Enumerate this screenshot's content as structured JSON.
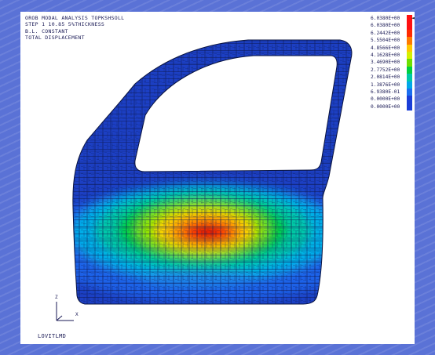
{
  "header": {
    "line1": "OROB MODAL ANALYSIS TOPKSHSOLL",
    "line2": "STEP 1 10.85 5%THICKNESS",
    "line3": "B.L. CONSTANT",
    "line4": "TOTAL DISPLACEMENT"
  },
  "legend": {
    "marker": "◄",
    "entries": [
      {
        "label": "6.0380E+00",
        "color": "#ff1010"
      },
      {
        "label": "6.0380E+00",
        "color": "#ff1010"
      },
      {
        "label": "6.2442E+00",
        "color": "#ff2a00"
      },
      {
        "label": "5.5504E+00",
        "color": "#ff7a00"
      },
      {
        "label": "4.8566E+00",
        "color": "#ffc800"
      },
      {
        "label": "4.1628E+00",
        "color": "#d6f000"
      },
      {
        "label": "3.4690E+00",
        "color": "#6ee000"
      },
      {
        "label": "2.7752E+00",
        "color": "#00d040"
      },
      {
        "label": "2.0814E+00",
        "color": "#00c8a8"
      },
      {
        "label": "1.3876E+00",
        "color": "#00a8e8"
      },
      {
        "label": "6.9380E-01",
        "color": "#1a6ef0"
      },
      {
        "label": "0.0000E+00",
        "color": "#1a3ed8"
      },
      {
        "label": "0.0000E+00",
        "color": "#1a3ed8"
      }
    ]
  },
  "axes": {
    "z_label": "Z",
    "x_label": "X"
  },
  "footer": {
    "label": "LOVITLMD"
  },
  "colors": {
    "background": "#5a72d6",
    "mesh_base": "#1e44c8",
    "viewport": "#ffffff"
  }
}
